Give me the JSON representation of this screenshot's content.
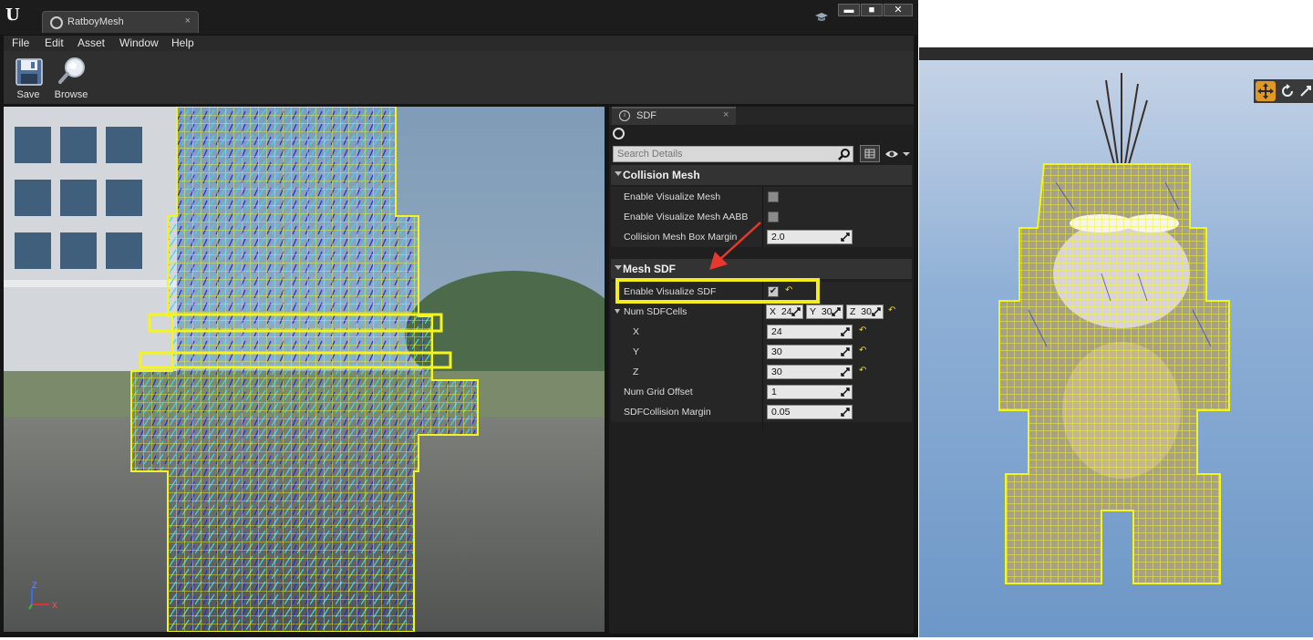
{
  "window": {
    "tab_title": "RatboyMesh",
    "tab_close": "×",
    "controls": {
      "minimize": "▬",
      "maximize": "■",
      "close": "✕"
    }
  },
  "menu": [
    "File",
    "Edit",
    "Asset",
    "Window",
    "Help"
  ],
  "toolbar": {
    "save_label": "Save",
    "browse_label": "Browse"
  },
  "viewport": {
    "axis_labels": {
      "z": "Z",
      "x": "X"
    }
  },
  "details": {
    "tab_label": "SDF",
    "tab_close": "×",
    "search_placeholder": "Search Details",
    "categories": {
      "collision": {
        "label": "Collision Mesh",
        "rows": {
          "enable_visualize_mesh": {
            "label": "Enable Visualize Mesh",
            "checked": false
          },
          "enable_visualize_mesh_aabb": {
            "label": "Enable Visualize Mesh AABB",
            "checked": false
          },
          "box_margin": {
            "label": "Collision Mesh Box Margin",
            "value": "2.0"
          }
        }
      },
      "mesh_sdf": {
        "label": "Mesh SDF",
        "rows": {
          "enable_visualize_sdf": {
            "label": "Enable Visualize SDF",
            "checked": true,
            "check_glyph": "✔"
          },
          "num_sdf_cells": {
            "label": "Num SDFCells",
            "x_label": "X",
            "x_value": "24",
            "y_label": "Y",
            "y_value": "30",
            "z_label": "Z",
            "z_value": "30"
          },
          "x": {
            "label": "X",
            "value": "24"
          },
          "y": {
            "label": "Y",
            "value": "30"
          },
          "z": {
            "label": "Z",
            "value": "30"
          },
          "num_grid_offset": {
            "label": "Num Grid Offset",
            "value": "1"
          },
          "sdf_collision_margin": {
            "label": "SDFCollision Margin",
            "value": "0.05"
          }
        }
      }
    }
  },
  "colors": {
    "highlight": "#f3ee19",
    "annotation_arrow": "#e8372b",
    "wireframe": "#f5f51e",
    "sdf_points_light": "#41d4f0",
    "sdf_points_dark": "#1f2ae0"
  }
}
